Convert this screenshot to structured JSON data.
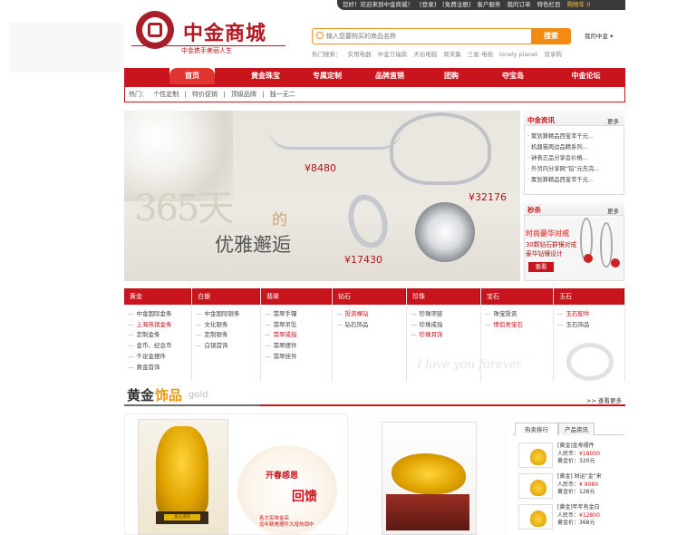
{
  "topbar": {
    "items": [
      "您好！欢迎来到中金商城！",
      "[登录]",
      "[免费注册]",
      "客户服务",
      "我的订单",
      "特色栏目"
    ],
    "cart": "购物车 0"
  },
  "logo": {
    "title": "中金商城",
    "slogan": "中金携手美丽人生"
  },
  "search": {
    "placeholder": "输入您要购买的商品名称",
    "button": "搜索",
    "my_center": "我的中金"
  },
  "hot_search": [
    "热门搜索：",
    "实用电器",
    "中金万福鼎",
    "天伯电脑",
    "周末集",
    "三星 电视",
    "lonely planet",
    "双享购"
  ],
  "nav": {
    "items": [
      "首页",
      "黄金珠宝",
      "专属定制",
      "品牌直销",
      "团购",
      "夺宝岛",
      "中金论坛"
    ]
  },
  "quick_links": [
    "热门：",
    "个性定制",
    "|",
    "特价促销",
    "|",
    "顶级品牌",
    "|",
    "独一无二"
  ],
  "banner": {
    "big": "365天",
    "de": "的",
    "sub": "优雅邂逅",
    "prices": [
      "¥8480",
      "¥32176",
      "¥17430"
    ]
  },
  "news": {
    "title": "中金资讯",
    "more": "更多",
    "items": [
      "聚划算精品西宝萃千元...",
      "机器猫周边品精系列...",
      "钟表正品分享会价格...",
      "外贸内分享网“铂”元先完...",
      "聚划算精品西宝萃千元..."
    ]
  },
  "flash": {
    "title": "秒杀",
    "more": "更多",
    "line1": "时尚豪华对戒",
    "line2": "30颗钻石群镶对戒\n豪华钻镶设计",
    "button": "查看"
  },
  "categories": [
    {
      "name": "黄金",
      "items": [
        {
          "t": "中金国际金条",
          "red": false
        },
        {
          "t": "上海热销金条",
          "red": true
        },
        {
          "t": "定制金条",
          "red": false
        },
        {
          "t": "金币、纪念币",
          "red": false
        },
        {
          "t": "千足金摆件",
          "red": false
        },
        {
          "t": "黄金首饰",
          "red": false
        }
      ]
    },
    {
      "name": "白银",
      "items": [
        {
          "t": "中金国际银条",
          "red": false
        },
        {
          "t": "文化银条",
          "red": false
        },
        {
          "t": "定制银条",
          "red": false
        },
        {
          "t": "白银首饰",
          "red": false
        }
      ]
    },
    {
      "name": "翡翠",
      "items": [
        {
          "t": "翡翠手镯",
          "red": false
        },
        {
          "t": "翡翠吊坠",
          "red": false
        },
        {
          "t": "翡翠戒指",
          "red": true
        },
        {
          "t": "翡翠摆件",
          "red": false
        },
        {
          "t": "翡翠挂件",
          "red": false
        }
      ]
    },
    {
      "name": "钻石",
      "items": [
        {
          "t": "投资裸钻",
          "red": true
        },
        {
          "t": "钻石饰品",
          "red": false
        }
      ]
    },
    {
      "name": "珍珠",
      "items": [
        {
          "t": "珍珠项链",
          "red": false
        },
        {
          "t": "珍珠戒指",
          "red": false
        },
        {
          "t": "珍珠耳饰",
          "red": true
        }
      ]
    },
    {
      "name": "宝石",
      "items": [
        {
          "t": "珠宝投资",
          "red": false
        },
        {
          "t": "情侣类宝石",
          "red": true
        }
      ]
    },
    {
      "name": "玉石",
      "items": [
        {
          "t": "玉石配件",
          "red": true
        },
        {
          "t": "玉石饰品",
          "red": false
        }
      ]
    }
  ],
  "watermark": "I love you forever",
  "section": {
    "title_a": "黄金",
    "title_b": "饰品",
    "en": "gold",
    "more": "查看更多"
  },
  "promo": {
    "kai": "开春感恩",
    "huikui": "回馈",
    "sub": "各大实体金店\n龙年精美摆件大增热销中",
    "statue_label": "金玉满堂"
  },
  "tabs": [
    "热卖排行",
    "产品资讯"
  ],
  "products": [
    {
      "name": "[黄金]金寿摆件",
      "price_label": "人民币：",
      "price": "¥18000",
      "gold_label": "黄金价：",
      "gold": "320元"
    },
    {
      "name": "[黄金] 财运“金”来",
      "price_label": "人民币：",
      "price": "¥ 9080",
      "gold_label": "黄金价：",
      "gold": "128元"
    },
    {
      "name": "[黄金]年年有金白",
      "price_label": "人民币：",
      "price": "¥12800",
      "gold_label": "黄金价：",
      "gold": "368元"
    }
  ]
}
